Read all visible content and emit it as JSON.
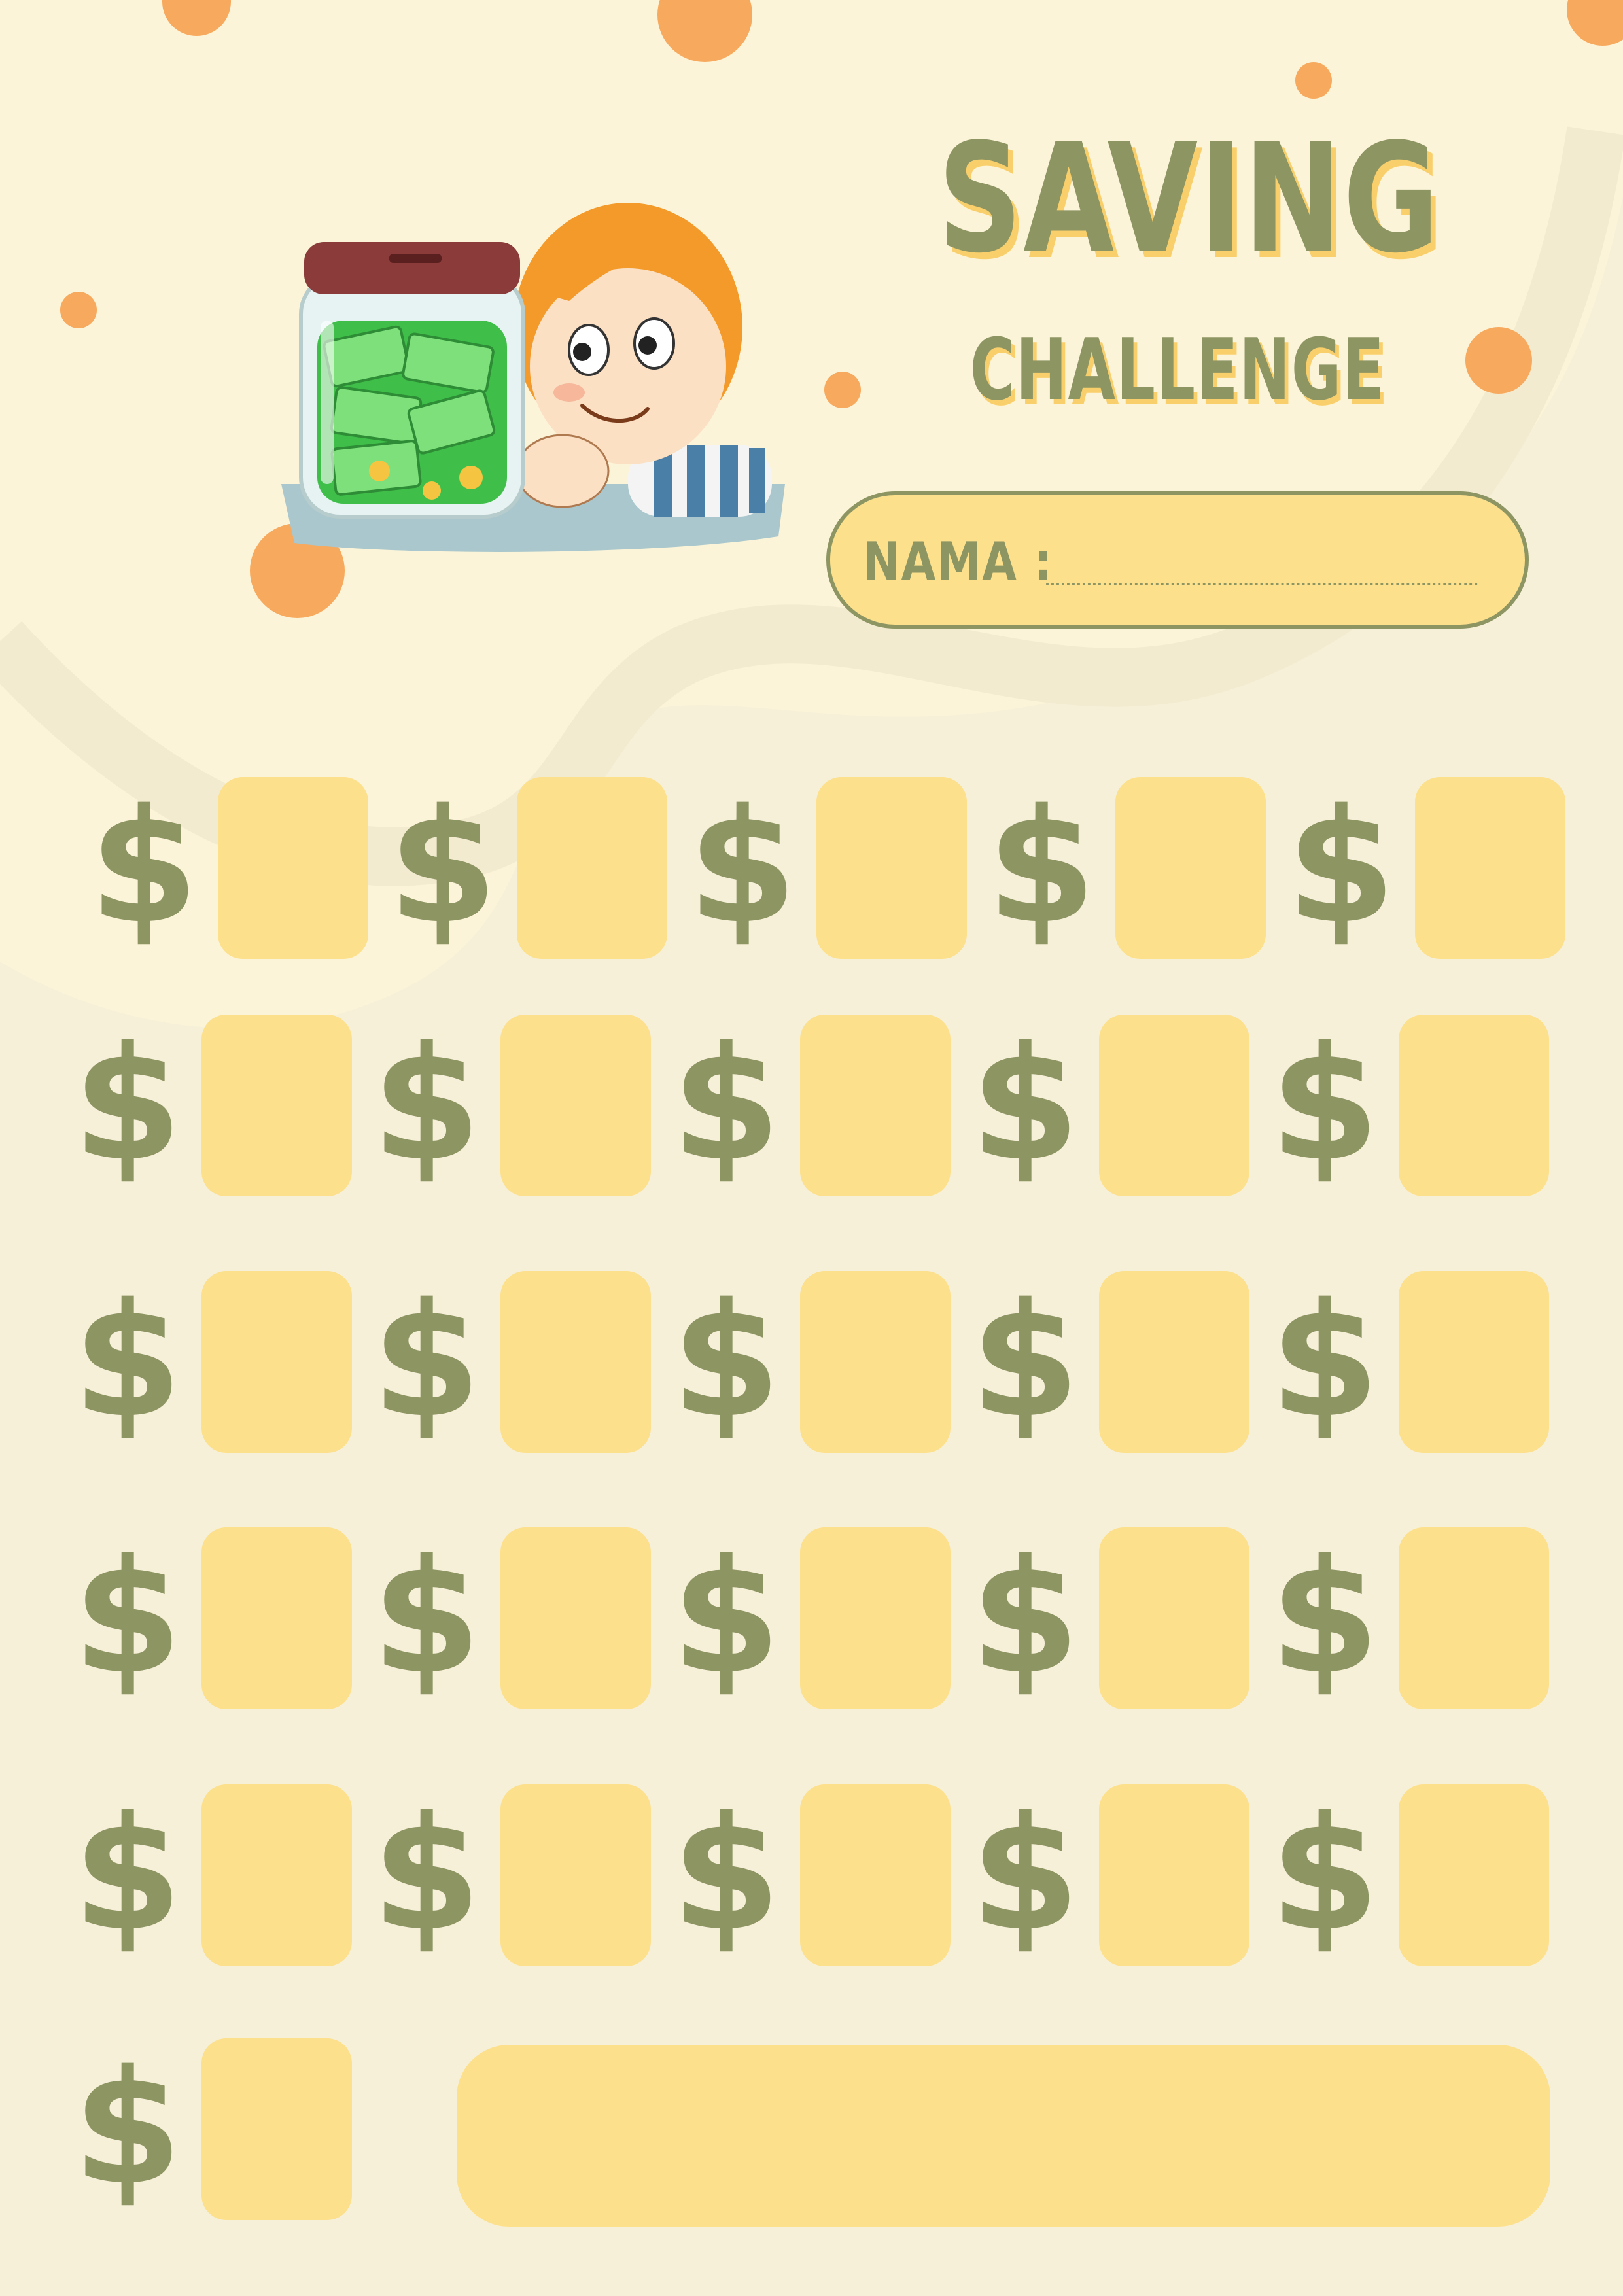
{
  "header": {
    "title": "SAVING",
    "subtitle": "CHALLENGE"
  },
  "name_field": {
    "label": "NAMA :",
    "value": ""
  },
  "tracker": {
    "symbol": "$",
    "grid_rows": 5,
    "grid_cols": 5,
    "last_row_cells": 1,
    "has_wide_total_box": true
  },
  "colors": {
    "background": "#f7f0d9",
    "olive": "#8d9563",
    "box_yellow": "#fde08c",
    "title_shadow": "#f9cf6b",
    "dot_orange": "#f7a95e"
  },
  "illustration": {
    "description_icon": "boy-with-money-jar-icon"
  }
}
